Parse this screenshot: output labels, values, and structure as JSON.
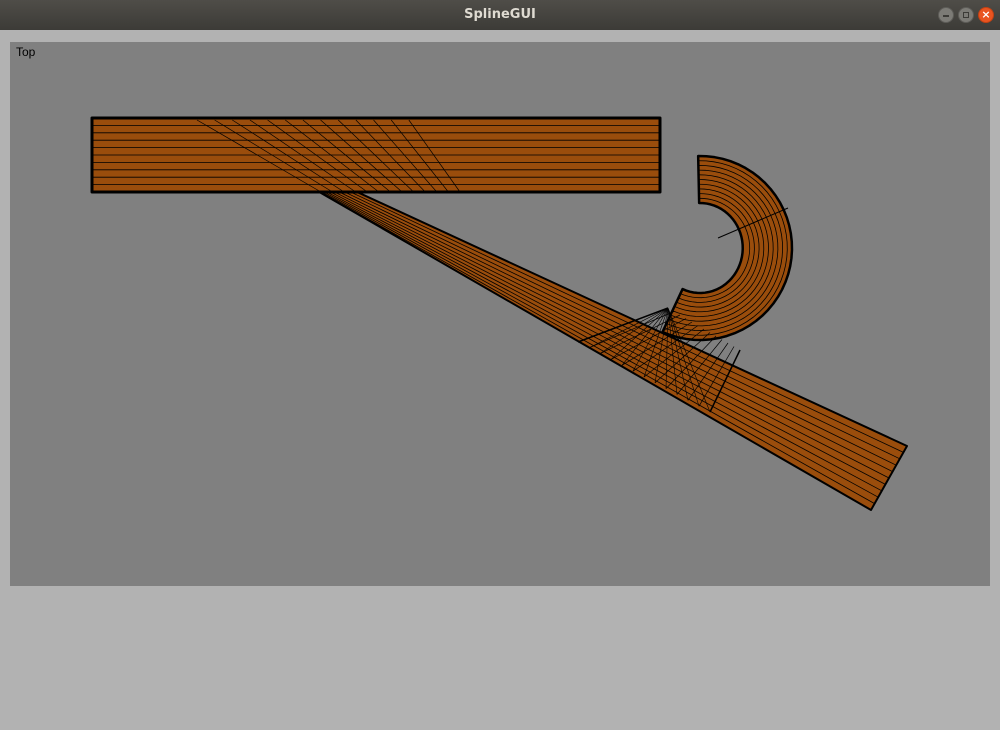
{
  "window": {
    "title": "SplineGUI",
    "controls": {
      "minimize_icon": "minimize-icon",
      "maximize_icon": "maximize-icon",
      "close_icon": "close-icon"
    }
  },
  "viewport": {
    "label": "Top",
    "background": "#808080",
    "mesh_fill": "#9a4d0c",
    "mesh_line": "#000000",
    "status_area_color": "#b2b2b2"
  }
}
